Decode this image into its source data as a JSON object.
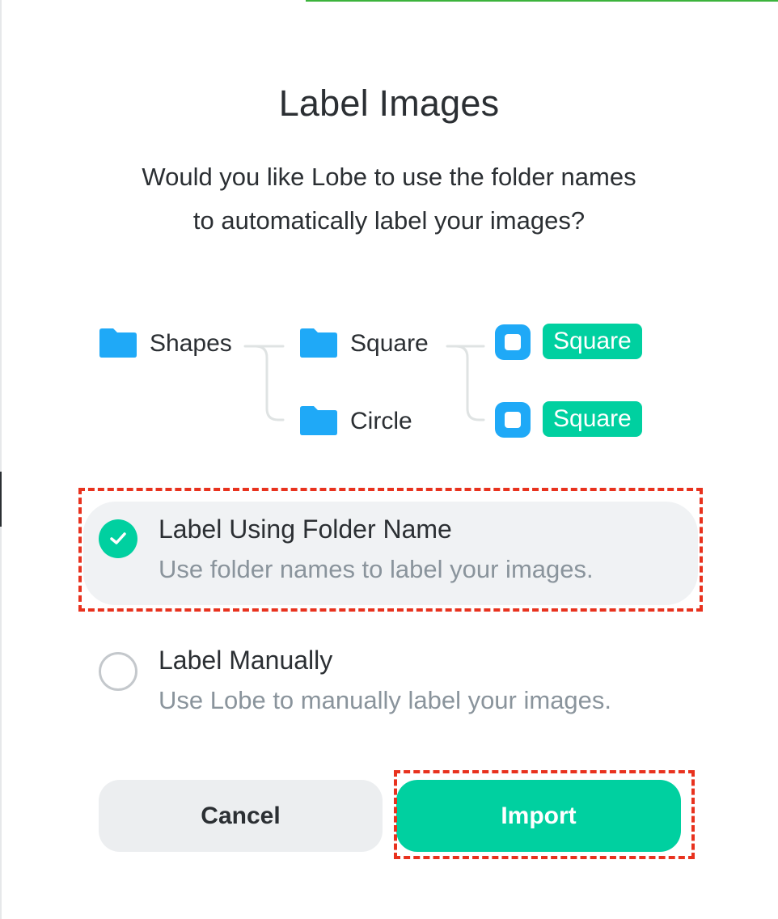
{
  "dialog": {
    "title": "Label Images",
    "subtitle_line1": "Would you like Lobe to use the folder names",
    "subtitle_line2": "to automatically label your images?"
  },
  "diagram": {
    "root_folder": "Shapes",
    "child_folders": [
      "Square",
      "Circle"
    ],
    "result_labels": [
      "Square",
      "Square"
    ]
  },
  "options": [
    {
      "title": "Label Using Folder Name",
      "description": "Use folder names to label your images.",
      "selected": true
    },
    {
      "title": "Label Manually",
      "description": "Use Lobe to manually label your images.",
      "selected": false
    }
  ],
  "buttons": {
    "cancel": "Cancel",
    "import": "Import"
  },
  "colors": {
    "accent": "#00d0a0",
    "folder": "#1fa9f7",
    "highlight": "#e8321e",
    "progress": "#3cb33c"
  },
  "icons": {
    "folder": "folder-icon",
    "image": "image-icon",
    "check": "check-icon",
    "radio_empty": "radio-empty-icon"
  }
}
